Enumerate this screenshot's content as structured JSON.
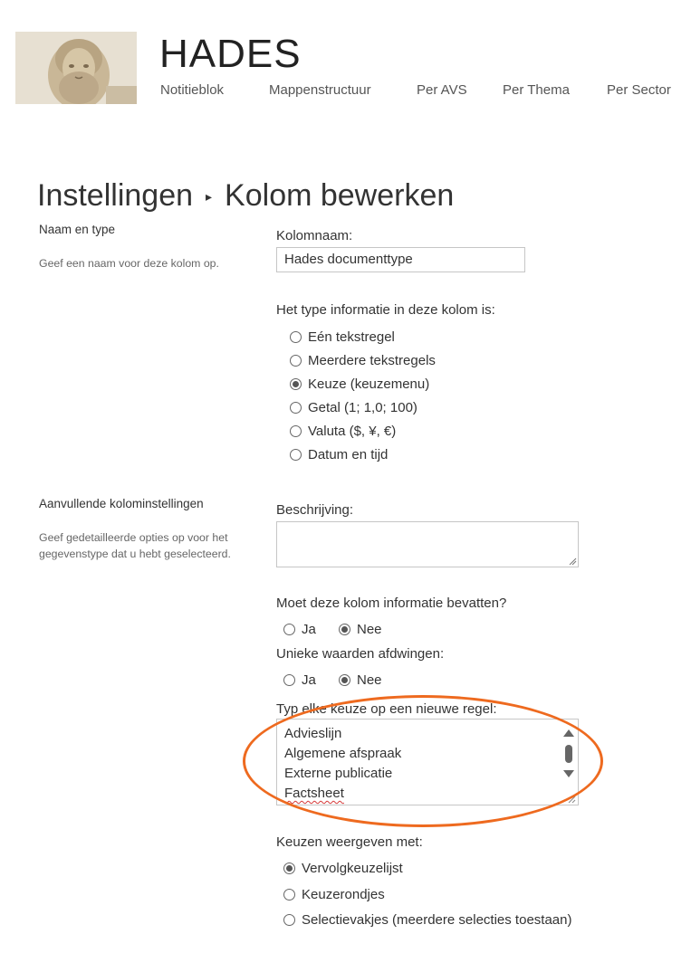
{
  "site": {
    "title": "HADES",
    "nav": [
      "Notitieblok",
      "Mappenstructuur",
      "Per AVS",
      "Per Thema",
      "Per Sector"
    ]
  },
  "breadcrumb": {
    "parent": "Instellingen",
    "separator": "▸",
    "current": "Kolom bewerken"
  },
  "section_name_type": {
    "title": "Naam en type",
    "description": "Geef een naam voor deze kolom op.",
    "column_name_label": "Kolomnaam:",
    "column_name_value": "Hades documenttype",
    "type_question": "Het type informatie in deze kolom is:",
    "type_options": [
      {
        "label": "Eén tekstregel",
        "selected": false
      },
      {
        "label": "Meerdere tekstregels",
        "selected": false
      },
      {
        "label": "Keuze (keuzemenu)",
        "selected": true
      },
      {
        "label": "Getal (1; 1,0; 100)",
        "selected": false
      },
      {
        "label": "Valuta ($, ¥, €)",
        "selected": false
      },
      {
        "label": "Datum en tijd",
        "selected": false
      }
    ]
  },
  "section_additional": {
    "title": "Aanvullende kolominstellingen",
    "description_lines": [
      "Geef gedetailleerde opties op voor het",
      "gegevenstype dat u hebt geselecteerd."
    ],
    "description_label": "Beschrijving:",
    "description_value": "",
    "required_question": "Moet deze kolom informatie bevatten?",
    "required_options": [
      {
        "label": "Ja",
        "selected": false
      },
      {
        "label": "Nee",
        "selected": true
      }
    ],
    "unique_question": "Unieke waarden afdwingen:",
    "unique_options": [
      {
        "label": "Ja",
        "selected": false
      },
      {
        "label": "Nee",
        "selected": true
      }
    ],
    "choices_label": "Typ elke keuze op een nieuwe regel:",
    "choices": [
      "Advieslijn",
      "Algemene afspraak",
      "Externe publicatie",
      "Factsheet"
    ],
    "display_label": "Keuzen weergeven met:",
    "display_options": [
      {
        "label": "Vervolgkeuzelijst",
        "selected": true
      },
      {
        "label": "Keuzerondjes",
        "selected": false
      },
      {
        "label": "Selectievakjes (meerdere selecties toestaan)",
        "selected": false
      }
    ]
  },
  "colors": {
    "highlight": "#ee6a1f",
    "text": "#333333",
    "muted": "#666666",
    "border": "#c6c6c6"
  },
  "icons": {
    "breadcrumb_separator": "triangle-right-icon",
    "scroll_up": "triangle-up-icon",
    "scroll_down": "triangle-down-icon"
  }
}
